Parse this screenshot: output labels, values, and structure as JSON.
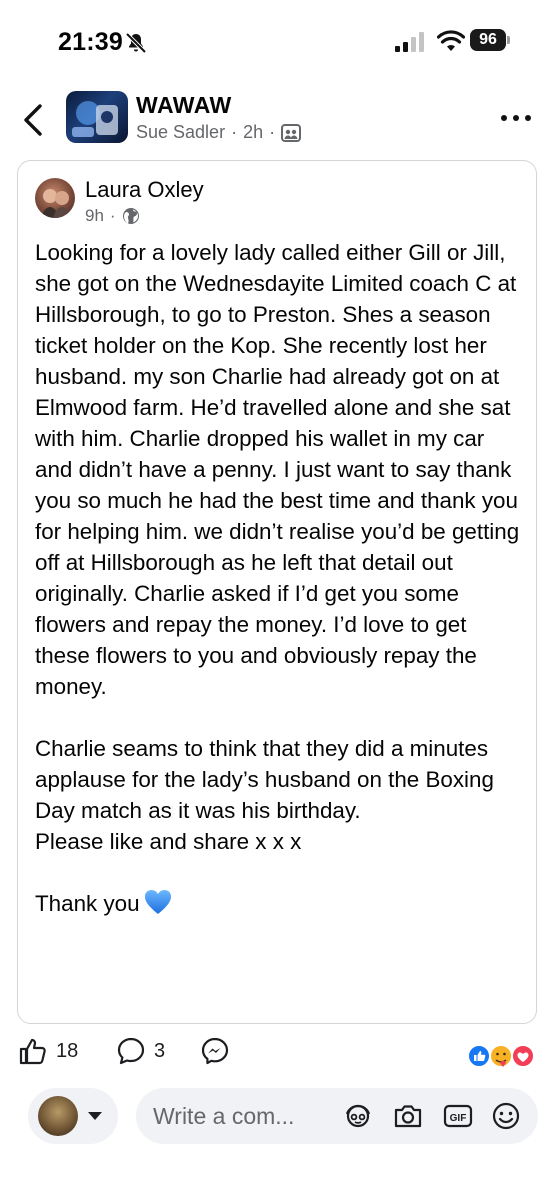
{
  "status": {
    "time": "21:39",
    "battery": "96",
    "icons": [
      "bell-slash-icon",
      "signal-icon",
      "wifi-icon",
      "battery-icon"
    ]
  },
  "header": {
    "title": "WAWAW",
    "poster": "Sue Sadler",
    "separator": "·",
    "age": "2h",
    "icons": [
      "back-chevron-icon",
      "group-members-icon",
      "more-dots-icon"
    ]
  },
  "post": {
    "author": "Laura Oxley",
    "age": "9h",
    "separator": "·",
    "icons": [
      "globe-icon"
    ],
    "text": "Looking for a lovely lady called either Gill or Jill, she got on the Wednesdayite Limited coach C at Hillsborough, to go to Preston. Shes a season ticket holder on the Kop. She recently lost her husband. my son Charlie had already got on at Elmwood farm. He’d travelled alone and she sat with him. Charlie dropped his wallet in my car and didn’t have a penny. I just want to say thank you so much he had the best time and thank you for helping him. we didn’t realise you’d be getting off at Hillsborough as he left that detail out originally. Charlie asked if I’d get you some flowers and repay the money. I’d love to get these flowers to you and obviously repay the money.\n\nCharlie seams to think that they did a minutes applause for the lady’s husband on the Boxing Day match as it was his birthday.\nPlease like and share x x x\n\nThank you",
    "closing_emoji": "blue-heart-icon"
  },
  "actions": {
    "likes": "18",
    "comments": "3",
    "icons": [
      "like-icon",
      "comment-icon",
      "messenger-icon"
    ],
    "reaction_icons": [
      "like-reaction-icon",
      "care-reaction-icon",
      "love-reaction-icon"
    ]
  },
  "composer": {
    "placeholder": "Write a com...",
    "icons": [
      "avatar-sticker-icon",
      "camera-icon",
      "gif-icon",
      "emoji-icon"
    ]
  },
  "colors": {
    "text": "#050505",
    "secondary": "#65676b",
    "input_bg": "#f0f2f5",
    "fb_blue": "#1877f2",
    "love_red": "#f33e58"
  }
}
